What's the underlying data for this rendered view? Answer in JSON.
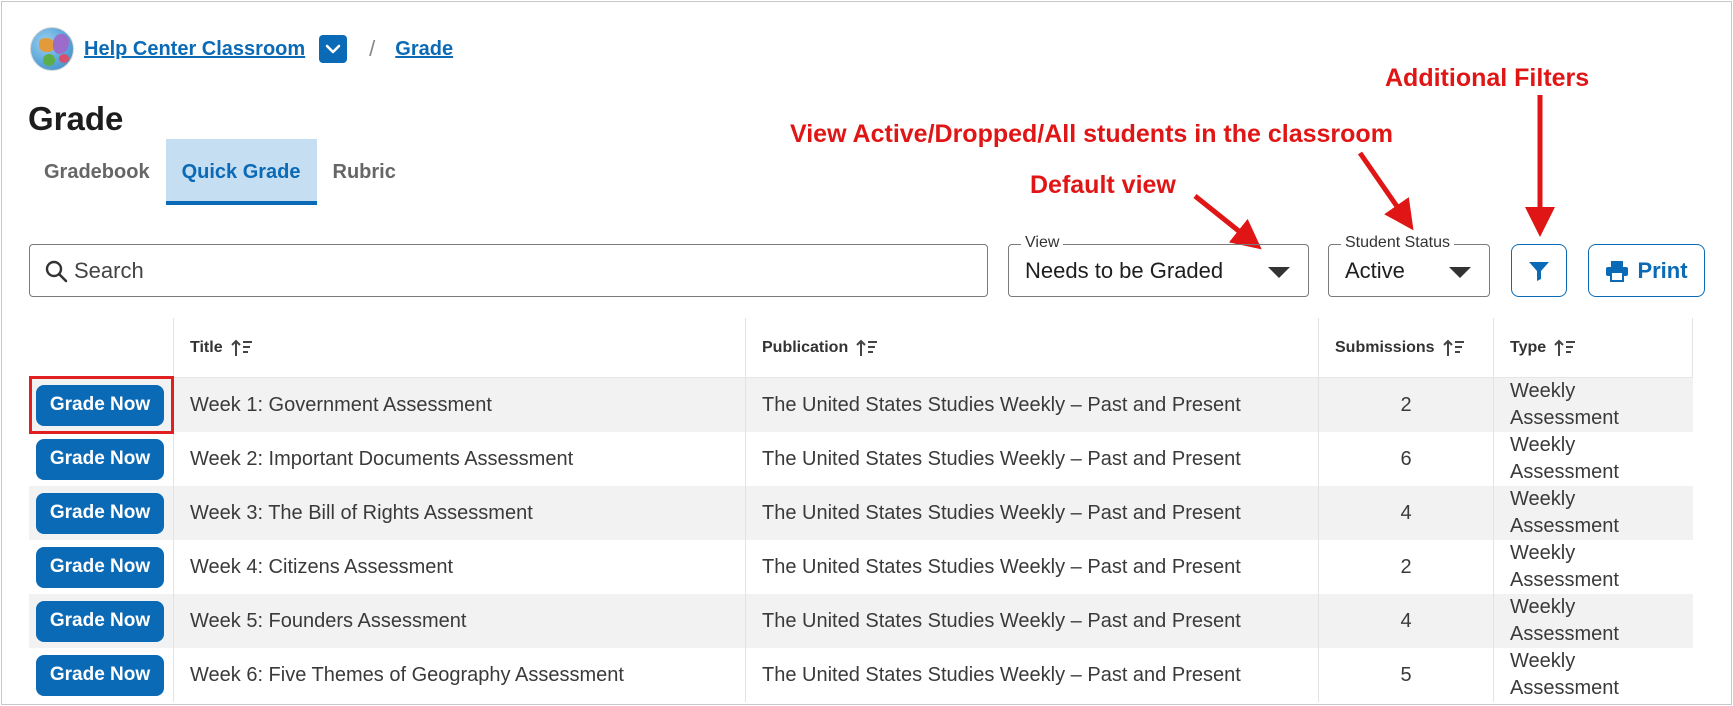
{
  "breadcrumb": {
    "classroom": "Help Center Classroom",
    "separator": "/",
    "current": "Grade"
  },
  "page_title": "Grade",
  "tabs": [
    {
      "label": "Gradebook",
      "active": false
    },
    {
      "label": "Quick Grade",
      "active": true
    },
    {
      "label": "Rubric",
      "active": false
    }
  ],
  "annotations": {
    "additional_filters": "Additional Filters",
    "student_status_note": "View Active/Dropped/All students in the classroom",
    "default_view": "Default view"
  },
  "search": {
    "placeholder": "Search"
  },
  "view_select": {
    "legend": "View",
    "value": "Needs to be Graded"
  },
  "status_select": {
    "legend": "Student Status",
    "value": "Active"
  },
  "print_label": "Print",
  "table": {
    "headers": [
      "Title",
      "Publication",
      "Submissions",
      "Type"
    ],
    "action_label": "Grade Now",
    "rows": [
      {
        "title": "Week 1: Government Assessment",
        "publication": "The United States Studies Weekly – Past and Present",
        "submissions": "2",
        "type_line1": "Weekly",
        "type_line2": "Assessment"
      },
      {
        "title": "Week 2: Important Documents Assessment",
        "publication": "The United States Studies Weekly – Past and Present",
        "submissions": "6",
        "type_line1": "Weekly",
        "type_line2": "Assessment"
      },
      {
        "title": "Week 3: The Bill of Rights Assessment",
        "publication": "The United States Studies Weekly – Past and Present",
        "submissions": "4",
        "type_line1": "Weekly",
        "type_line2": "Assessment"
      },
      {
        "title": "Week 4: Citizens Assessment",
        "publication": "The United States Studies Weekly – Past and Present",
        "submissions": "2",
        "type_line1": "Weekly",
        "type_line2": "Assessment"
      },
      {
        "title": "Week 5: Founders Assessment",
        "publication": "The United States Studies Weekly – Past and Present",
        "submissions": "4",
        "type_line1": "Weekly",
        "type_line2": "Assessment"
      },
      {
        "title": "Week 6: Five Themes of Geography Assessment",
        "publication": "The United States Studies Weekly – Past and Present",
        "submissions": "5",
        "type_line1": "Weekly",
        "type_line2": "Assessment"
      }
    ]
  },
  "colors": {
    "accent": "#0b6ab6",
    "annotation": "#e01616",
    "tab_active_bg": "#c6def2"
  },
  "icons": [
    "globe-logo",
    "chevron-down-icon",
    "search-icon",
    "caret-down-icon",
    "filter-icon",
    "printer-icon",
    "sort-icon"
  ]
}
